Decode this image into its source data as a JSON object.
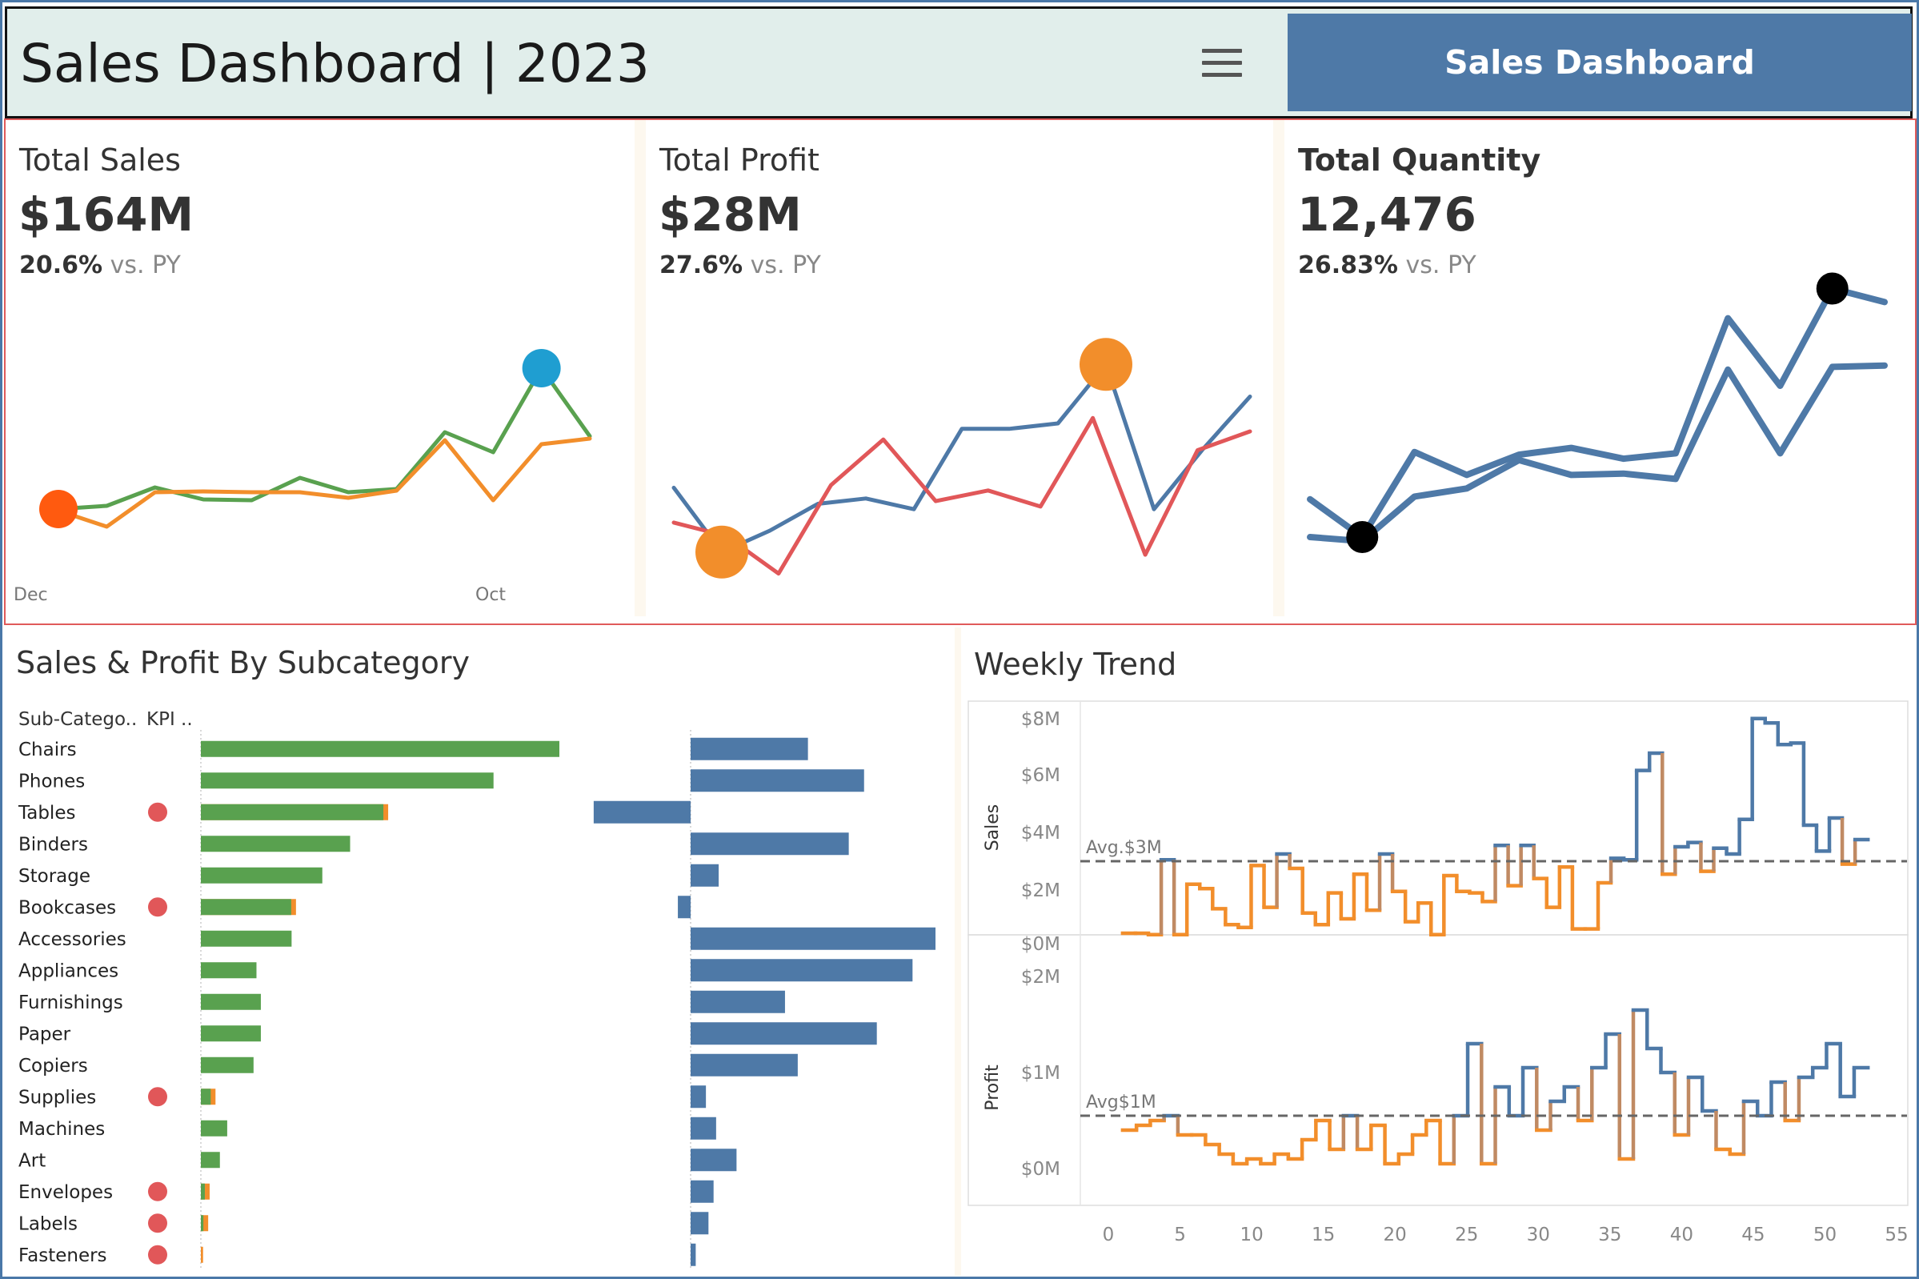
{
  "header": {
    "title": "Sales Dashboard | 2023",
    "nav_button_label": "Sales Dashboard"
  },
  "kpis": [
    {
      "title": "Total Sales",
      "value": "$164M",
      "change": "20.6%",
      "change_suffix": "vs. PY",
      "axis_start": "Dec",
      "axis_end": "Oct"
    },
    {
      "title": "Total Profit",
      "value": "$28M",
      "change": "27.6%",
      "change_suffix": "vs. PY"
    },
    {
      "title": "Total Quantity",
      "value": "12,476",
      "change": "26.83%",
      "change_suffix": "vs. PY"
    }
  ],
  "subcategory": {
    "title": "Sales & Profit By Subcategory",
    "col_subcategory": "Sub-Catego..",
    "col_kpi": "KPI .."
  },
  "weekly": {
    "title": "Weekly Trend",
    "sales_axis_label": "Sales",
    "profit_axis_label": "Profit",
    "sales_avg_label": "Avg.$3M",
    "profit_avg_label": "Avg$1M"
  },
  "colors": {
    "sales_green": "#59a14f",
    "profit_blue": "#4e79a7",
    "below_orange": "#f28e2b",
    "kpi_red": "#e15759",
    "marker_blue": "#1f9ed1",
    "marker_red": "#ff5a0f",
    "header_bg": "#e1eeeb"
  },
  "chart_data": [
    {
      "type": "line",
      "title": "Total Sales",
      "series": [
        {
          "values": [
            10.4,
            10.8,
            13.1,
            11.6,
            11.5,
            14.3,
            12.5,
            12.9,
            20.0,
            17.5,
            28.0,
            19.5
          ]
        },
        {
          "values": [
            10.2,
            8.2,
            12.5,
            12.6,
            12.5,
            12.5,
            11.8,
            12.7,
            19.0,
            11.5,
            18.5,
            19.2
          ]
        }
      ],
      "ylim": [
        6,
        30
      ]
    },
    {
      "type": "line",
      "title": "Total Profit",
      "series": [
        {
          "values": [
            1.8,
            0.6,
            1.0,
            1.5,
            1.6,
            1.4,
            2.9,
            2.9,
            3.0,
            4.1,
            1.4,
            2.5,
            3.5
          ]
        },
        {
          "values": [
            1.15,
            0.9,
            0.2,
            1.85,
            2.7,
            1.55,
            1.75,
            1.45,
            3.1,
            0.55,
            2.5,
            2.85
          ]
        }
      ],
      "ylim": [
        0,
        5
      ]
    },
    {
      "type": "line",
      "title": "Total Quantity",
      "series": [
        {
          "values": [
            400,
            260,
            575,
            490,
            565,
            590,
            550,
            570,
            1070,
            820,
            1180,
            1130
          ]
        },
        {
          "values": [
            260,
            245,
            410,
            440,
            545,
            490,
            495,
            475,
            880,
            570,
            890,
            895
          ]
        }
      ],
      "ylim": [
        100,
        1300
      ]
    },
    {
      "type": "bar",
      "title": "Sales & Profit By Subcategory",
      "categories": [
        "Chairs",
        "Phones",
        "Tables",
        "Binders",
        "Storage",
        "Bookcases",
        "Accessories",
        "Appliances",
        "Furnishings",
        "Paper",
        "Copiers",
        "Supplies",
        "Machines",
        "Art",
        "Envelopes",
        "Labels",
        "Fasteners"
      ],
      "kpi_flag": [
        false,
        false,
        true,
        false,
        false,
        true,
        false,
        false,
        false,
        false,
        false,
        true,
        false,
        false,
        true,
        true,
        true
      ],
      "series": [
        {
          "values": [
            24.5,
            20.0,
            12.8,
            10.2,
            8.3,
            6.5,
            6.2,
            3.8,
            4.1,
            4.1,
            3.6,
            1.0,
            1.8,
            1.3,
            0.6,
            0.5,
            0.15
          ]
        },
        {
          "values": [
            2.3,
            3.4,
            -1.9,
            3.1,
            0.55,
            -0.25,
            4.8,
            4.35,
            1.85,
            3.65,
            2.1,
            0.3,
            0.5,
            0.9,
            0.45,
            0.35,
            0.1
          ]
        }
      ]
    },
    {
      "type": "line",
      "title": "Weekly Trend",
      "x": [
        1,
        2,
        3,
        4,
        5,
        6,
        7,
        8,
        9,
        10,
        11,
        12,
        13,
        14,
        15,
        16,
        17,
        18,
        19,
        20,
        21,
        22,
        23,
        24,
        25,
        26,
        27,
        28,
        29,
        30,
        31,
        32,
        33,
        34,
        35,
        36,
        37,
        38,
        39,
        40,
        41,
        42,
        43,
        44,
        45,
        46,
        47,
        48,
        49,
        50,
        51,
        52
      ],
      "xlim": [
        0,
        55
      ],
      "xticks": [
        0,
        5,
        10,
        15,
        20,
        25,
        30,
        35,
        40,
        45,
        50,
        55
      ],
      "series": [
        {
          "name": "Sales",
          "avg": 3.0,
          "ylim": [
            0,
            8
          ],
          "yticks": [
            "$0M",
            "$2M",
            "$4M",
            "$6M",
            "$8M"
          ],
          "values": [
            0.5,
            0.5,
            0.45,
            3.05,
            0.45,
            2.2,
            2.05,
            1.35,
            0.8,
            0.7,
            2.85,
            1.4,
            3.25,
            2.75,
            1.2,
            0.8,
            1.9,
            1.0,
            2.55,
            1.3,
            3.25,
            1.95,
            0.9,
            1.55,
            0.45,
            2.5,
            1.95,
            1.9,
            1.6,
            3.55,
            2.15,
            3.55,
            2.4,
            1.4,
            2.8,
            0.65,
            0.65,
            2.25,
            3.1,
            3.05,
            6.15,
            6.75,
            2.55,
            3.5,
            3.65,
            2.65,
            3.45,
            3.25,
            4.45,
            7.95,
            7.8,
            7.05,
            7.1,
            4.25,
            3.35,
            4.5,
            2.9,
            3.75
          ]
        },
        {
          "name": "Profit",
          "avg": 0.55,
          "ylim": [
            -0.25,
            2
          ],
          "yticks": [
            "$0M",
            "$1M",
            "$2M"
          ],
          "values": [
            0.4,
            0.45,
            0.5,
            0.55,
            0.35,
            0.35,
            0.25,
            0.15,
            0.05,
            0.1,
            0.05,
            0.15,
            0.1,
            0.3,
            0.5,
            0.2,
            0.55,
            0.2,
            0.45,
            0.05,
            0.15,
            0.35,
            0.5,
            0.05,
            0.55,
            1.3,
            0.05,
            0.85,
            0.55,
            1.05,
            0.4,
            0.7,
            0.85,
            0.5,
            1.05,
            1.4,
            0.1,
            1.65,
            1.25,
            1.0,
            0.35,
            0.95,
            0.6,
            0.2,
            0.15,
            0.7,
            0.55,
            0.9,
            0.5,
            0.95,
            1.05,
            1.3,
            0.75,
            1.05
          ]
        }
      ]
    }
  ]
}
